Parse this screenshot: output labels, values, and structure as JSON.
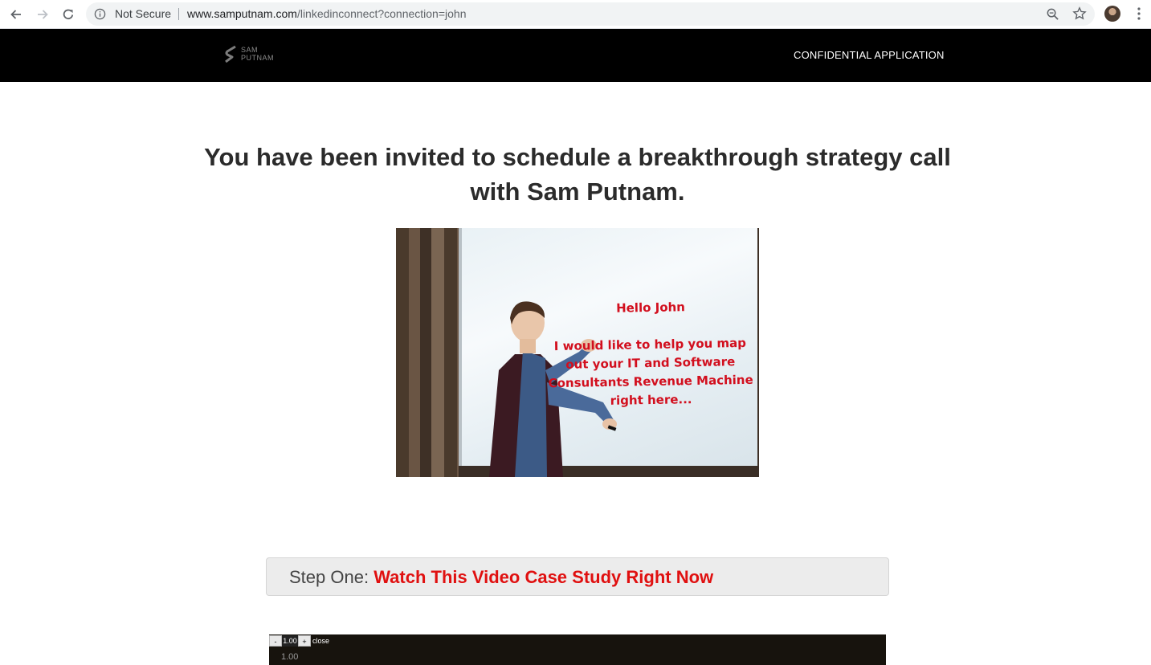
{
  "browser": {
    "security_label": "Not Secure",
    "url_host": "www.samputnam.com",
    "url_path": "/linkedinconnect?connection=john"
  },
  "header": {
    "logo_line1": "SAM",
    "logo_line2": "PUTNAM",
    "nav_link": "CONFIDENTIAL APPLICATION"
  },
  "main": {
    "headline": "You have been invited to schedule a breakthrough strategy call with Sam Putnam.",
    "hero": {
      "greeting": "Hello John",
      "message": "I would like to help you map out your IT and Software Consultants Revenue Machine right here..."
    },
    "step": {
      "prefix": "Step One:",
      "cta": "Watch This Video Case Study Right Now"
    },
    "video_controls": {
      "decrease": "-",
      "value": "1.00",
      "increase": "+",
      "close": "close",
      "readout": "1.00"
    }
  },
  "colors": {
    "header_bg": "#000000",
    "cta_red": "#e01010",
    "board_red": "#d20f1e"
  }
}
